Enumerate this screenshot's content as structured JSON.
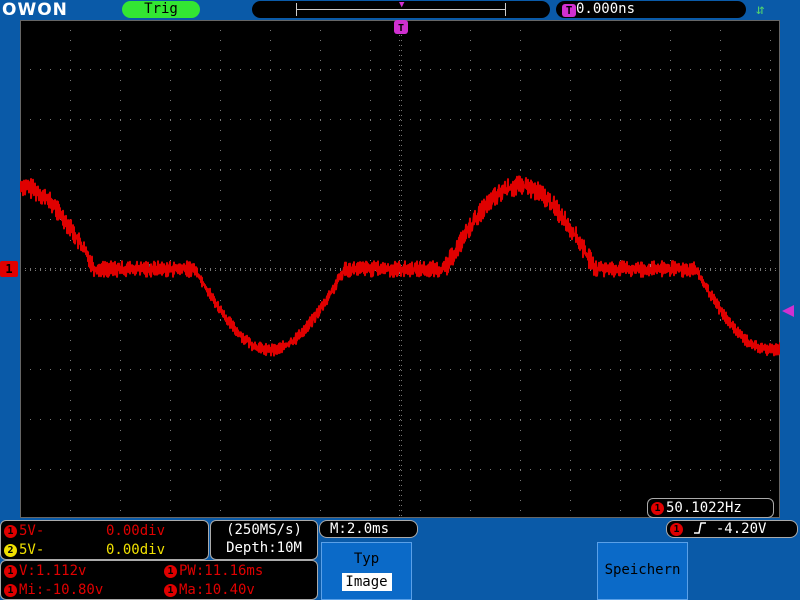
{
  "top_bar": {
    "logo": "OWON",
    "trigger_status": "Trig",
    "trigger_position": "0.000ns",
    "trigger_position_icon": "T",
    "usb_icon": "usb-icon"
  },
  "screen": {
    "ch1_marker": "1",
    "frequency_channel": "1",
    "frequency": "50.1022Hz"
  },
  "channels": [
    {
      "id": "1",
      "scale": "5V-",
      "offset": "0.00div",
      "color": "#e00000"
    },
    {
      "id": "2",
      "scale": "5V-",
      "offset": "0.00div",
      "color": "#f0e000"
    }
  ],
  "acquisition": {
    "sample_rate": "(250MS/s)",
    "depth": "Depth:10M"
  },
  "measurements": {
    "v": "V:1.112v",
    "pw": "PW:11.16ms",
    "min": "Mi:-10.80v",
    "max": "Ma:10.40v"
  },
  "timebase": "M:2.0ms",
  "trigger": {
    "channel": "1",
    "level": "-4.20V",
    "edge": "rising-edge-icon"
  },
  "softkeys": {
    "typ_label": "Typ",
    "typ_value": "Image",
    "save_label": "Speichern"
  },
  "colors": {
    "background": "#0a5aa8",
    "ch1": "#e00000",
    "ch2": "#f0e000",
    "trigger": "#d030d0",
    "trig_ok": "#33e633"
  }
}
